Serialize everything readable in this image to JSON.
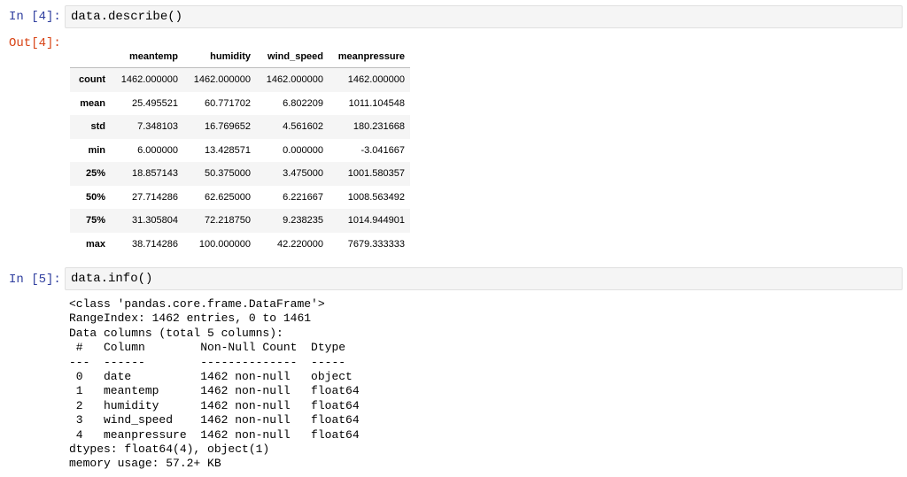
{
  "cells": {
    "describe": {
      "prompt_in": "In [4]:",
      "code": "data.describe()",
      "prompt_out": "Out[4]:",
      "table": {
        "columns": [
          "meantemp",
          "humidity",
          "wind_speed",
          "meanpressure"
        ],
        "rows": [
          {
            "index": "count",
            "values": [
              "1462.000000",
              "1462.000000",
              "1462.000000",
              "1462.000000"
            ]
          },
          {
            "index": "mean",
            "values": [
              "25.495521",
              "60.771702",
              "6.802209",
              "1011.104548"
            ]
          },
          {
            "index": "std",
            "values": [
              "7.348103",
              "16.769652",
              "4.561602",
              "180.231668"
            ]
          },
          {
            "index": "min",
            "values": [
              "6.000000",
              "13.428571",
              "0.000000",
              "-3.041667"
            ]
          },
          {
            "index": "25%",
            "values": [
              "18.857143",
              "50.375000",
              "3.475000",
              "1001.580357"
            ]
          },
          {
            "index": "50%",
            "values": [
              "27.714286",
              "62.625000",
              "6.221667",
              "1008.563492"
            ]
          },
          {
            "index": "75%",
            "values": [
              "31.305804",
              "72.218750",
              "9.238235",
              "1014.944901"
            ]
          },
          {
            "index": "max",
            "values": [
              "38.714286",
              "100.000000",
              "42.220000",
              "7679.333333"
            ]
          }
        ]
      }
    },
    "info": {
      "prompt_in": "In [5]:",
      "code": "data.info()",
      "output": "<class 'pandas.core.frame.DataFrame'>\nRangeIndex: 1462 entries, 0 to 1461\nData columns (total 5 columns):\n #   Column        Non-Null Count  Dtype  \n---  ------        --------------  -----  \n 0   date          1462 non-null   object \n 1   meantemp      1462 non-null   float64\n 2   humidity      1462 non-null   float64\n 3   wind_speed    1462 non-null   float64\n 4   meanpressure  1462 non-null   float64\ndtypes: float64(4), object(1)\nmemory usage: 57.2+ KB"
    }
  },
  "colors": {
    "prompt_in": "#303f9f",
    "prompt_out": "#d84315",
    "cell_bg": "#f5f5f5",
    "row_stripe": "#f5f5f5"
  }
}
